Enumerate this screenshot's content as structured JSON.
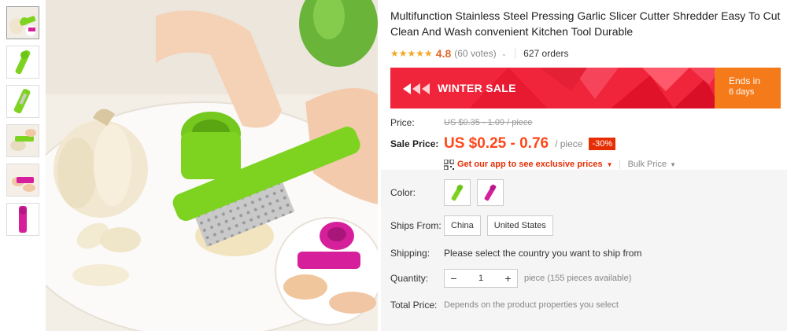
{
  "product": {
    "title": "Multifunction Stainless Steel Pressing Garlic Slicer Cutter Shredder Easy To Cut Clean And Wash convenient Kitchen Tool Durable",
    "stars": "★★★★★",
    "rating": "4.8",
    "votes": "(60 votes)",
    "orders": "627 orders"
  },
  "banner": {
    "label": "WINTER SALE",
    "ends_line1": "Ends in",
    "ends_line2": "6 days",
    "color": "#f0243a",
    "ends_color": "#f47a1a"
  },
  "pricing": {
    "price_label": "Price:",
    "old_price": "US $0.35 - 1.09 / piece",
    "sale_label": "Sale Price:",
    "sale_price": "US $0.25 - 0.76",
    "per_unit": "/ piece",
    "discount": "-30%",
    "app_promo": "Get our app to see exclusive prices",
    "bulk": "Bulk Price"
  },
  "options": {
    "color_label": "Color:",
    "colors": [
      "green",
      "magenta"
    ],
    "ships_from_label": "Ships From:",
    "ships_from": [
      "China",
      "United States"
    ],
    "shipping_label": "Shipping:",
    "shipping_text": "Please select the country you want to ship from",
    "quantity_label": "Quantity:",
    "quantity_value": "1",
    "quantity_note": "piece (155 pieces available)",
    "total_label": "Total Price:",
    "total_text": "Depends on the product properties you select"
  },
  "colors": {
    "accent": "#ff4719",
    "green_product": "#7ed321",
    "magenta_product": "#d6209b"
  }
}
